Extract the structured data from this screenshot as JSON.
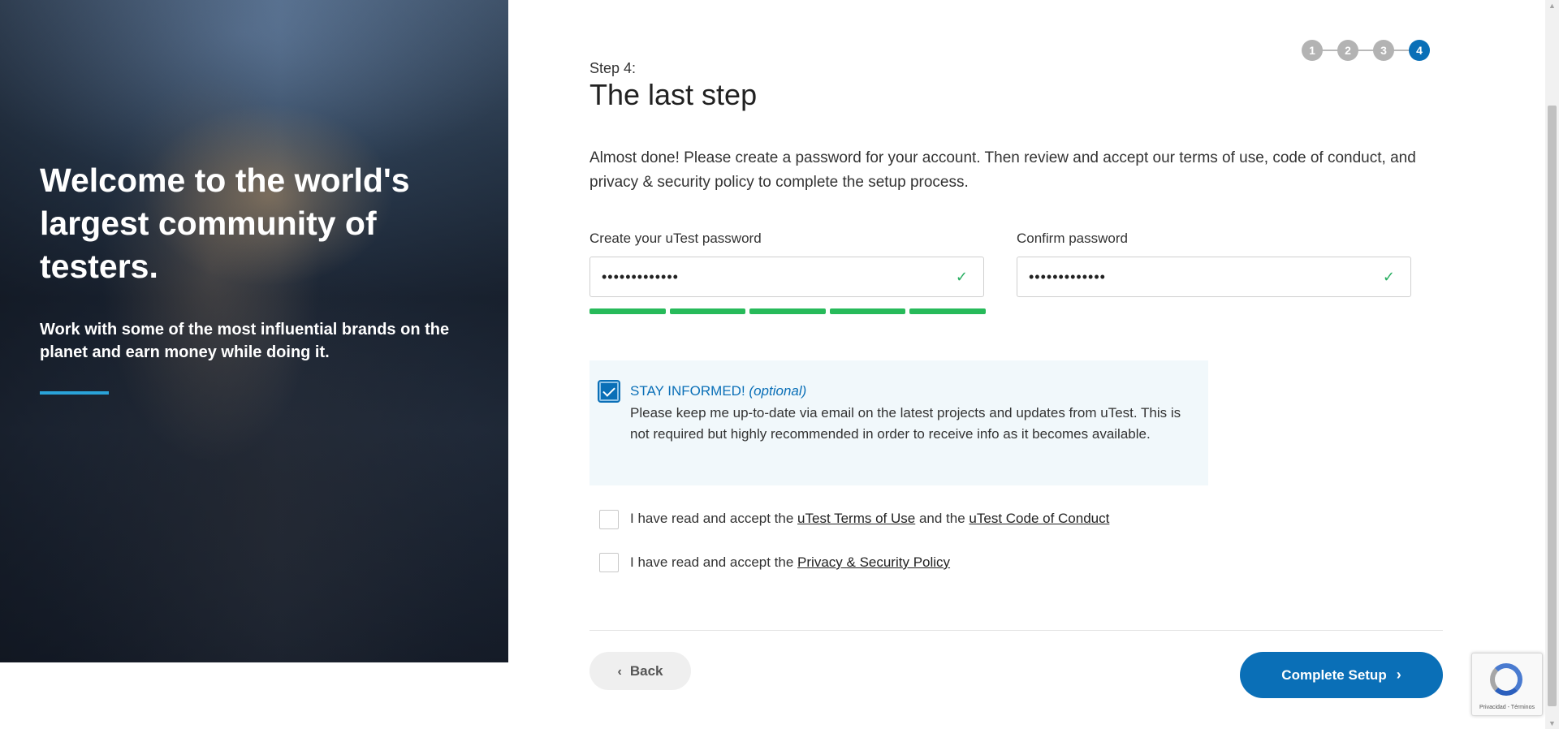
{
  "hero": {
    "title": "Welcome to the world's largest community of testers.",
    "subtitle": "Work with some of the most influential brands on the planet and earn money while doing it."
  },
  "step": {
    "label": "Step 4:",
    "title": "The last step",
    "steps": [
      "1",
      "2",
      "3",
      "4"
    ],
    "current": 4
  },
  "intro": "Almost done! Please create a password for your account. Then review and accept our terms of use, code of conduct, and privacy & security policy to complete the setup process.",
  "password": {
    "label": "Create your uTest password",
    "value": "•••••••••••••",
    "valid_icon": "check-icon",
    "strength_segments": 5,
    "strength_level": 1.0
  },
  "confirm": {
    "label": "Confirm password",
    "value": "•••••••••••••",
    "valid_icon": "check-icon"
  },
  "stay_informed": {
    "checked": true,
    "heading": "STAY INFORMED!",
    "optional": "(optional)",
    "body": "Please keep me up-to-date via email on the latest projects and updates from uTest. This is not required but highly recommended in order to receive info as it becomes available."
  },
  "terms": {
    "checked": false,
    "prefix": "I have read and accept the ",
    "link1": "uTest Terms of Use",
    "middle": " and the ",
    "link2": "uTest Code of Conduct"
  },
  "privacy": {
    "checked": false,
    "prefix": "I have read and accept the ",
    "link": "Privacy & Security Policy"
  },
  "buttons": {
    "back": "Back",
    "complete": "Complete Setup"
  },
  "recaptcha": {
    "text": "Privacidad - Términos"
  },
  "colors": {
    "brand_blue": "#0a6fb7",
    "success_green": "#27ba5a",
    "informed_bg": "#f1f8fb"
  }
}
